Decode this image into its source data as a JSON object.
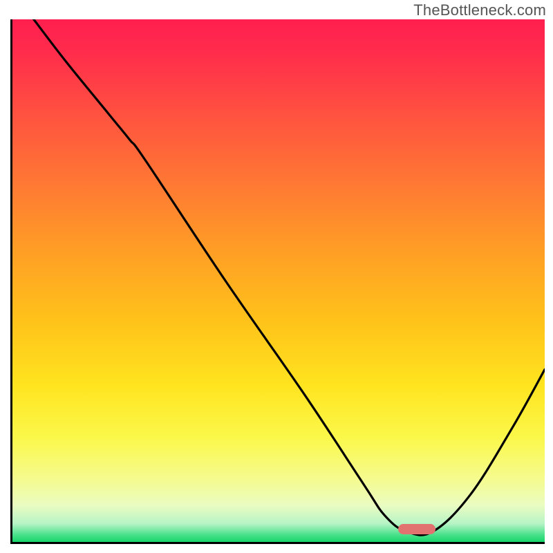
{
  "watermark": "TheBottleneck.com",
  "chart_data": {
    "type": "line",
    "title": "",
    "xlabel": "",
    "ylabel": "",
    "xlim": [
      0,
      100
    ],
    "ylim": [
      0,
      100
    ],
    "grid": false,
    "gradient_stops": [
      {
        "pos": 0.0,
        "color": "#ff1f4f"
      },
      {
        "pos": 0.06,
        "color": "#ff2b4c"
      },
      {
        "pos": 0.18,
        "color": "#ff5140"
      },
      {
        "pos": 0.32,
        "color": "#ff7a33"
      },
      {
        "pos": 0.45,
        "color": "#ffa024"
      },
      {
        "pos": 0.58,
        "color": "#ffc31a"
      },
      {
        "pos": 0.7,
        "color": "#ffe41f"
      },
      {
        "pos": 0.8,
        "color": "#fbf84a"
      },
      {
        "pos": 0.88,
        "color": "#f5fb8f"
      },
      {
        "pos": 0.93,
        "color": "#eafcc1"
      },
      {
        "pos": 0.965,
        "color": "#b6f4c6"
      },
      {
        "pos": 0.985,
        "color": "#4fe28e"
      },
      {
        "pos": 1.0,
        "color": "#17d56a"
      }
    ],
    "series": [
      {
        "name": "bottleneck-curve",
        "color": "#000000",
        "x": [
          4,
          10,
          18,
          22,
          25,
          40,
          55,
          66,
          70,
          74,
          79,
          86,
          94,
          100
        ],
        "y": [
          100,
          92,
          82,
          77,
          73,
          50,
          28,
          11,
          5,
          2,
          2,
          9,
          22,
          33
        ]
      }
    ],
    "marker": {
      "name": "optimal-range",
      "x_center": 76,
      "y_center": 2.5,
      "color": "#e1726f"
    }
  }
}
